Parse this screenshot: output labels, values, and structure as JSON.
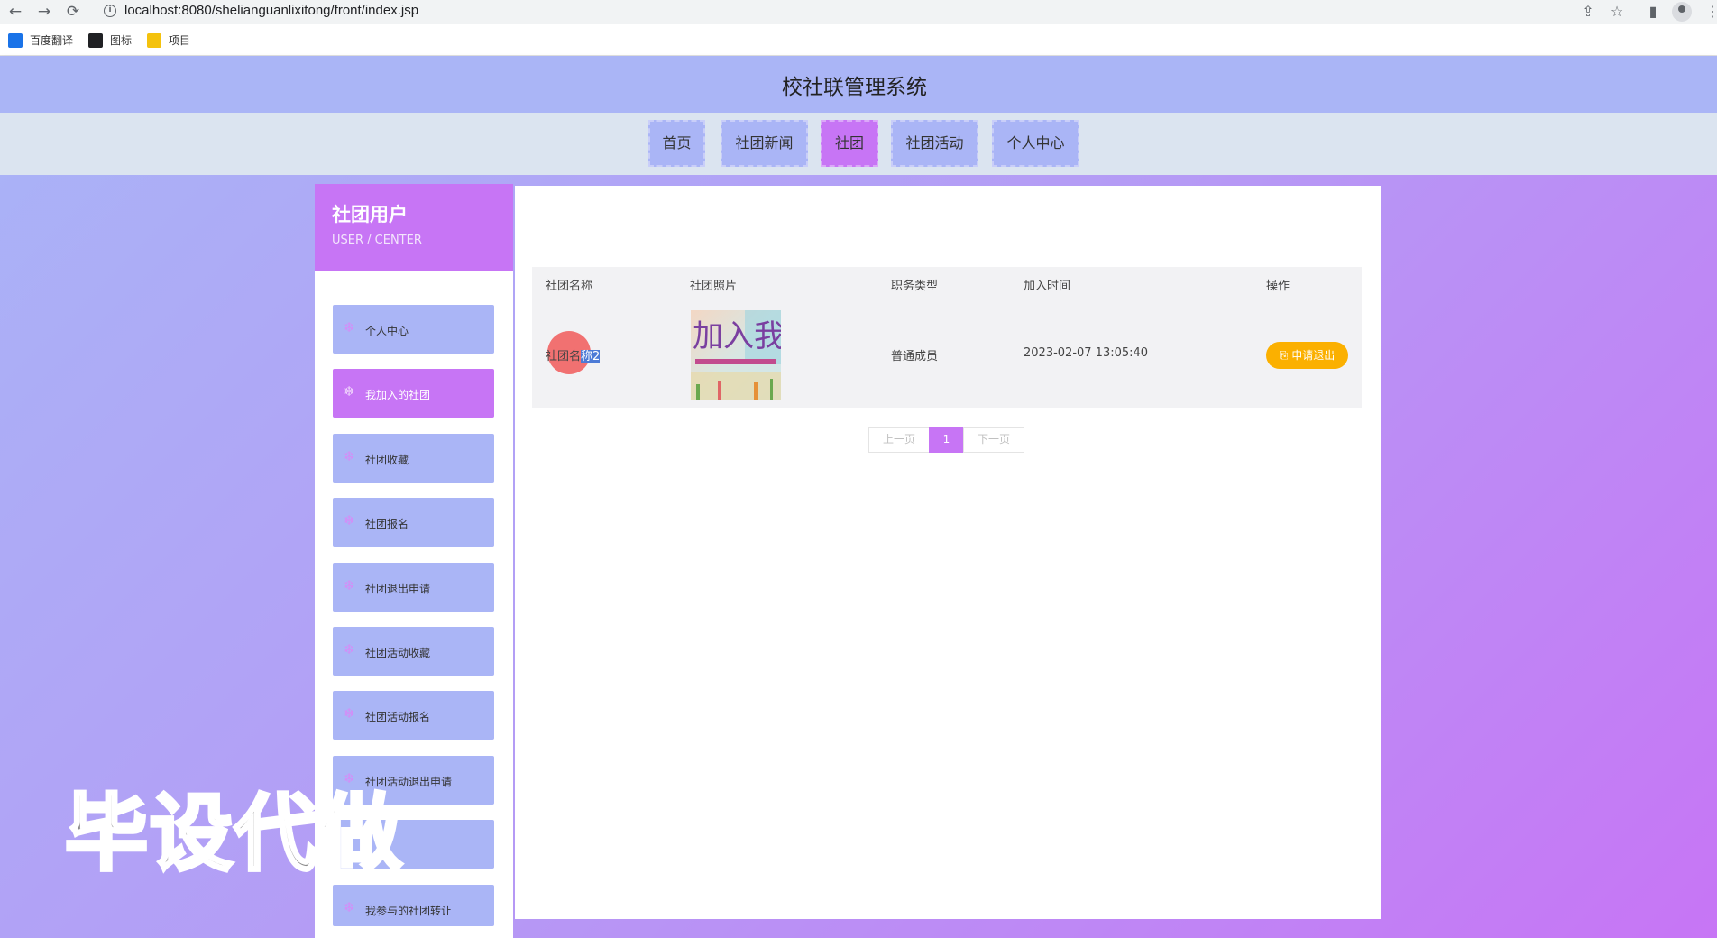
{
  "browser": {
    "url": "localhost:8080/shelianguanlixitong/front/index.jsp",
    "bookmarks": [
      {
        "label": "百度翻译",
        "icon": "translate-icon",
        "color": "#1a73e8"
      },
      {
        "label": "图标",
        "icon": "image-icon",
        "color": "#202124"
      },
      {
        "label": "项目",
        "icon": "folder-icon",
        "color": "#f4c20d"
      }
    ]
  },
  "site": {
    "title": "校社联管理系统",
    "nav": [
      {
        "label": "首页",
        "active": false
      },
      {
        "label": "社团新闻",
        "active": false
      },
      {
        "label": "社团",
        "active": true
      },
      {
        "label": "社团活动",
        "active": false
      },
      {
        "label": "个人中心",
        "active": false
      }
    ]
  },
  "sidebar": {
    "title": "社团用户",
    "subtitle": "USER / CENTER",
    "items": [
      {
        "label": "个人中心",
        "active": false
      },
      {
        "label": "我加入的社团",
        "active": true
      },
      {
        "label": "社团收藏",
        "active": false
      },
      {
        "label": "社团报名",
        "active": false
      },
      {
        "label": "社团退出申请",
        "active": false
      },
      {
        "label": "社团活动收藏",
        "active": false
      },
      {
        "label": "社团活动报名",
        "active": false
      },
      {
        "label": "社团活动退出申请",
        "active": false
      },
      {
        "label": "",
        "active": false
      },
      {
        "label": "我参与的社团转让",
        "active": false
      }
    ]
  },
  "table": {
    "headers": [
      "社团名称",
      "社团照片",
      "职务类型",
      "加入时间",
      "操作"
    ],
    "rows": [
      {
        "name_prefix": "社团名",
        "name_highlight": "称2",
        "photo_text": "加入我们",
        "role": "普通成员",
        "joined": "2023-02-07 13:05:40",
        "action": "申请退出"
      }
    ]
  },
  "pagination": {
    "prev": "上一页",
    "current": "1",
    "next": "下一页"
  },
  "watermark": "毕设代做",
  "colors": {
    "accent": "#c775f5",
    "nav_bg": "#aab5f6",
    "action": "#fbb000"
  }
}
